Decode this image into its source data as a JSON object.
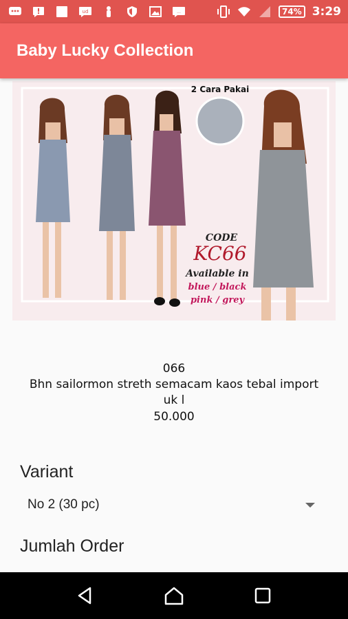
{
  "status_bar": {
    "battery": "74%",
    "time": "3:29",
    "icons": [
      "chat-icon",
      "notification-icon",
      "square-icon",
      "message-icon",
      "person-icon",
      "shield-icon",
      "image-icon",
      "sms-icon",
      "vibrate-icon",
      "wifi-icon",
      "signal-icon",
      "battery-icon"
    ]
  },
  "app_bar": {
    "title": "Baby Lucky Collection"
  },
  "product_image": {
    "caption": "2 Cara Pakai",
    "code_label": "CODE",
    "code": "KC66",
    "available_label": "Available in",
    "colors_line1": "blue / black",
    "colors_line2": "pink / grey"
  },
  "product": {
    "code": "066",
    "description": "Bhn sailormon streth semacam kaos tebal import",
    "size": "uk l",
    "price": "50.000"
  },
  "variant": {
    "label": "Variant",
    "selected": "No 2 (30 pc)"
  },
  "order": {
    "label": "Jumlah Order"
  },
  "nav": {
    "icons": [
      "back-icon",
      "home-icon",
      "recents-icon"
    ]
  }
}
